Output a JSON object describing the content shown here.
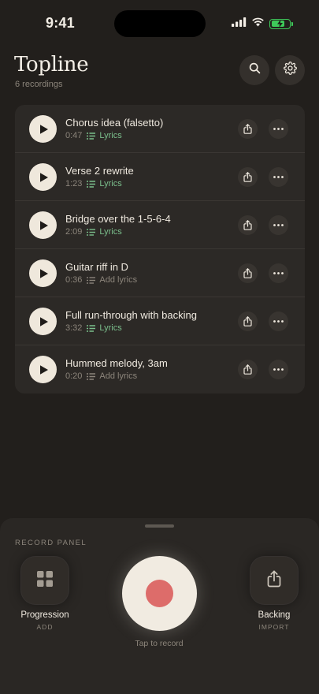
{
  "status_bar": {
    "time": "9:41",
    "battery_level": 0.8,
    "battery_color": "#3ec95a",
    "icons": [
      "signal-icon",
      "wifi-icon",
      "battery-charging-icon"
    ]
  },
  "header": {
    "title": "Topline",
    "subtitle": "6 recordings",
    "buttons": [
      "search-icon",
      "gear-icon"
    ]
  },
  "recordings": [
    {
      "title": "Chorus idea (falsetto)",
      "duration": "0:47",
      "lyrics_label": "Lyrics",
      "has_lyrics": true
    },
    {
      "title": "Verse 2 rewrite",
      "duration": "1:23",
      "lyrics_label": "Lyrics",
      "has_lyrics": true
    },
    {
      "title": "Bridge over the 1-5-6-4",
      "duration": "2:09",
      "lyrics_label": "Lyrics",
      "has_lyrics": true
    },
    {
      "title": "Guitar riff in D",
      "duration": "0:36",
      "lyrics_label": "Add lyrics",
      "has_lyrics": false
    },
    {
      "title": "Full run-through with backing",
      "duration": "3:32",
      "lyrics_label": "Lyrics",
      "has_lyrics": true
    },
    {
      "title": "Hummed melody, 3am",
      "duration": "0:20",
      "lyrics_label": "Add lyrics",
      "has_lyrics": false
    }
  ],
  "row_icons": [
    "play-icon",
    "lyrics-icon",
    "share-icon",
    "more-icon"
  ],
  "record_panel": {
    "label": "RECORD PANEL",
    "progression": {
      "label": "Progression",
      "sub": "ADD",
      "icon": "grid-icon"
    },
    "backing": {
      "label": "Backing",
      "sub": "IMPORT",
      "icon": "share-icon"
    },
    "record_hint": "Tap to record",
    "record_icon": "record-icon"
  },
  "colors": {
    "background": "#221f1c",
    "card": "#2c2926",
    "accent_green": "#7bbf8c",
    "record_red": "#dd6c6a",
    "cream": "#efe8dc"
  }
}
